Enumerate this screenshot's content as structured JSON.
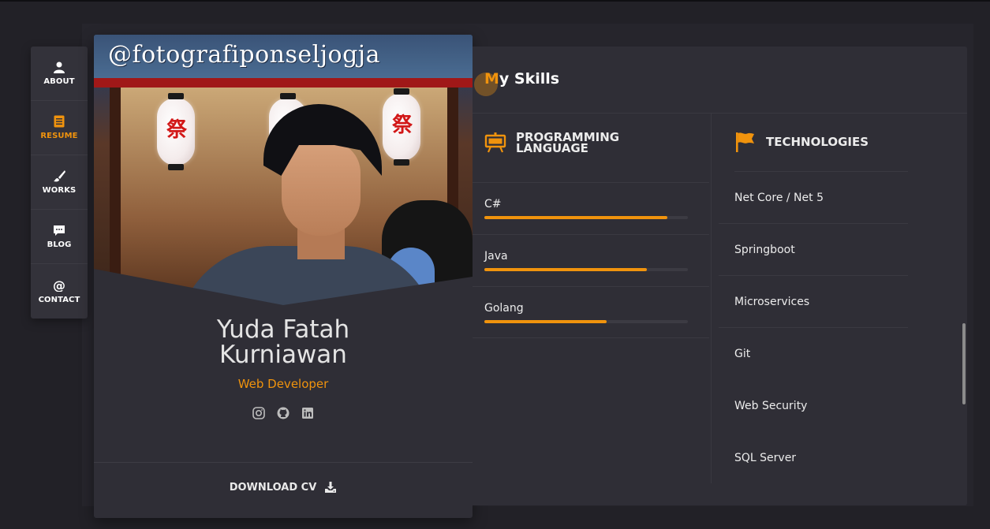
{
  "nav": {
    "items": [
      {
        "label": "ABOUT",
        "icon": "user-icon",
        "active": false
      },
      {
        "label": "RESUME",
        "icon": "document-icon",
        "active": true
      },
      {
        "label": "WORKS",
        "icon": "brush-icon",
        "active": false
      },
      {
        "label": "BLOG",
        "icon": "chat-icon",
        "active": false
      },
      {
        "label": "CONTACT",
        "icon": "at-icon",
        "active": false
      }
    ]
  },
  "profile": {
    "photo_watermark": "@fotografiponseljogja",
    "name_line1": "Yuda Fatah",
    "name_line2": "Kurniawan",
    "role": "Web Developer",
    "socials": [
      "instagram-icon",
      "github-icon",
      "linkedin-icon"
    ],
    "download_label": "DOWNLOAD CV"
  },
  "skills": {
    "title_first": "M",
    "title_rest": "y Skills",
    "programming": {
      "heading": "PROGRAMMING LANGUAGE",
      "items": [
        {
          "name": "C#",
          "level": 0.9
        },
        {
          "name": "Java",
          "level": 0.8
        },
        {
          "name": "Golang",
          "level": 0.6
        }
      ]
    },
    "technologies": {
      "heading": "TECHNOLOGIES",
      "items": [
        "Net Core / Net 5",
        "Springboot",
        "Microservices",
        "Git",
        "Web Security",
        "SQL Server"
      ]
    }
  },
  "colors": {
    "accent": "#f0930d",
    "background": "#222127",
    "panel": "#2f2e36"
  }
}
